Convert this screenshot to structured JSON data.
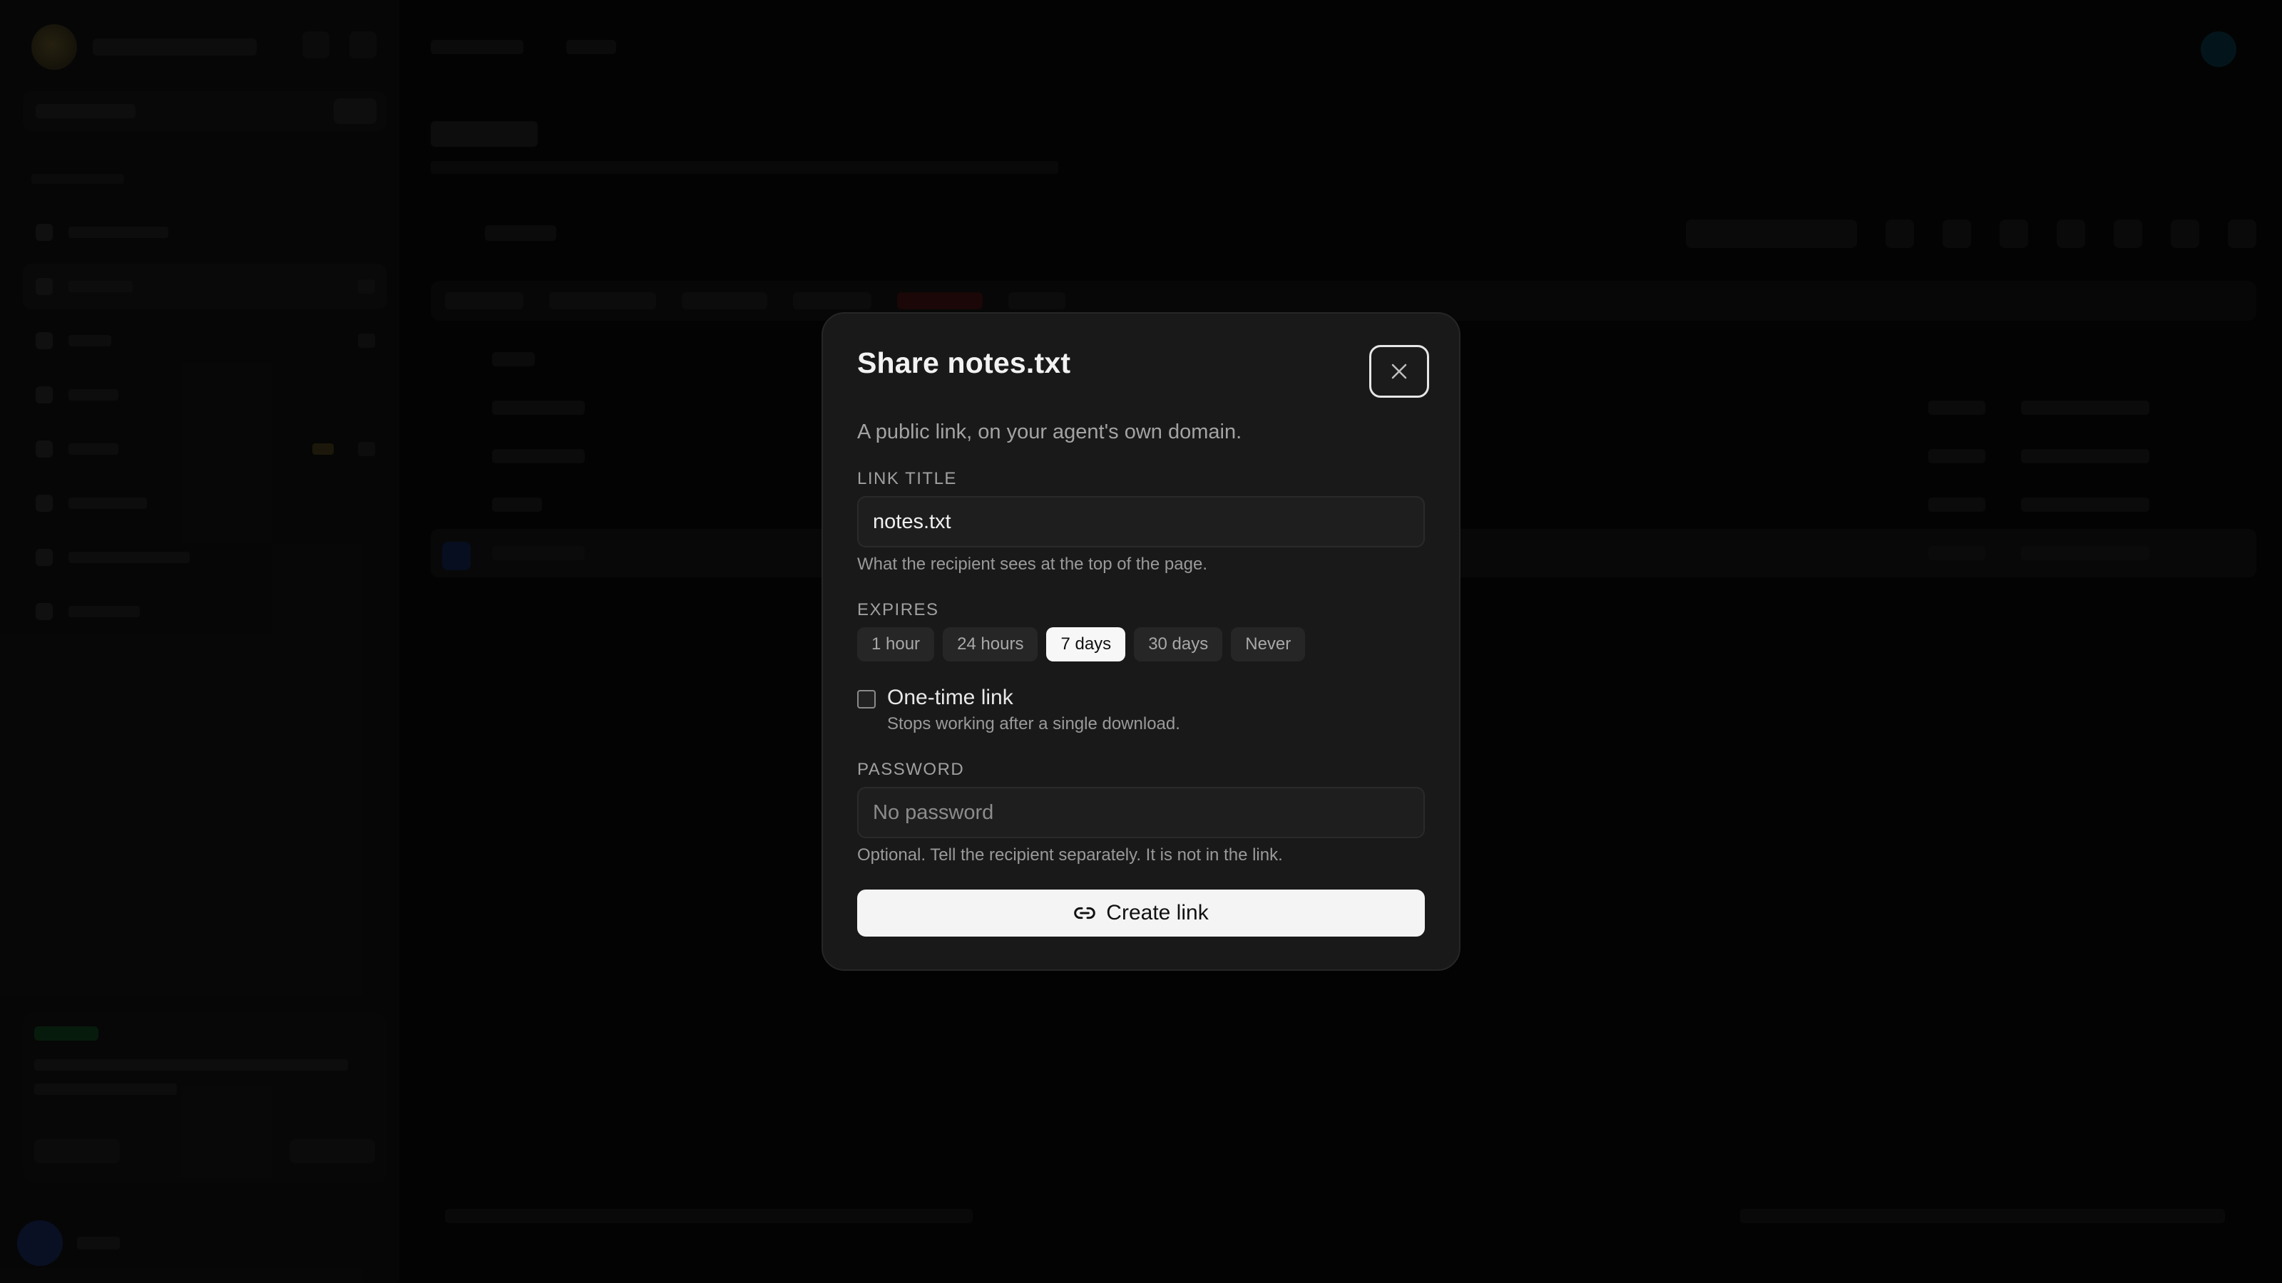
{
  "modal": {
    "title": "Share notes.txt",
    "description": "A public link, on your agent's own domain.",
    "link_title": {
      "label": "LINK TITLE",
      "value": "notes.txt",
      "hint": "What the recipient sees at the top of the page."
    },
    "expires": {
      "label": "EXPIRES",
      "options": [
        "1 hour",
        "24 hours",
        "7 days",
        "30 days",
        "Never"
      ],
      "selected": "7 days"
    },
    "one_time": {
      "label": "One-time link",
      "hint": "Stops working after a single download.",
      "checked": false
    },
    "password": {
      "label": "PASSWORD",
      "placeholder": "No password",
      "value": "",
      "hint": "Optional. Tell the recipient separately. It is not in the link."
    },
    "create_button": "Create link",
    "close_icon": "close-icon",
    "create_icon": "link-icon"
  }
}
